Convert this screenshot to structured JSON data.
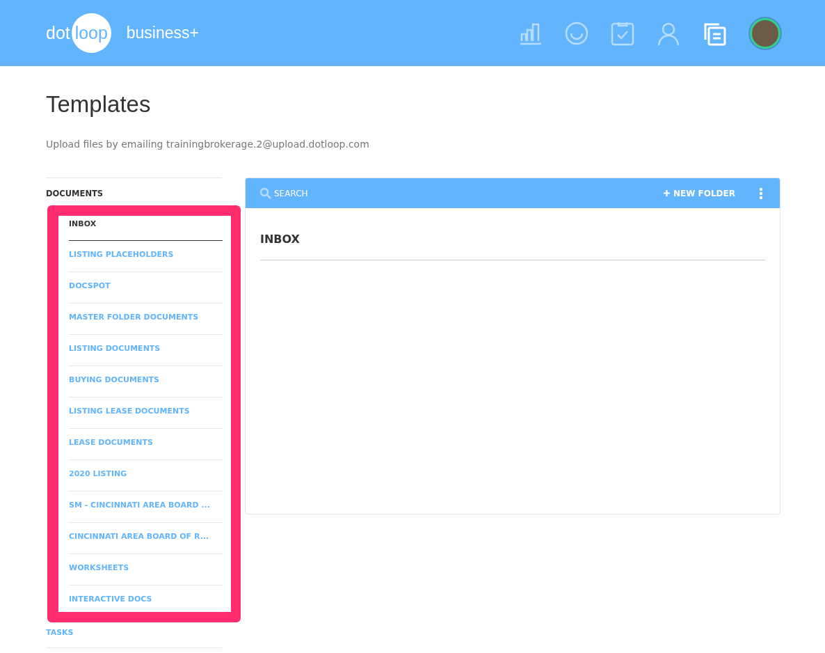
{
  "header": {
    "logo": {
      "left": "dot",
      "circle": "loop"
    },
    "plan": "business+",
    "nav_icons": [
      {
        "selected": false
      },
      {
        "selected": false
      },
      {
        "selected": false
      },
      {
        "selected": false
      },
      {
        "selected": true
      }
    ]
  },
  "page": {
    "title": "Templates",
    "subtitle": "Upload files by emailing trainingbrokerage.2@upload.dotloop.com"
  },
  "sidebar": {
    "section": "DOCUMENTS",
    "highlighted": true,
    "items": [
      {
        "label": "INBOX",
        "selected": true
      },
      {
        "label": "LISTING PLACEHOLDERS",
        "selected": false
      },
      {
        "label": "DOCSPOT",
        "selected": false
      },
      {
        "label": "MASTER FOLDER DOCUMENTS",
        "selected": false
      },
      {
        "label": "LISTING DOCUMENTS",
        "selected": false
      },
      {
        "label": "BUYING DOCUMENTS",
        "selected": false
      },
      {
        "label": "LISTING LEASE DOCUMENTS",
        "selected": false
      },
      {
        "label": "LEASE DOCUMENTS",
        "selected": false
      },
      {
        "label": "2020 LISTING",
        "selected": false
      },
      {
        "label": "SM - CINCINNATI AREA BOARD ...",
        "selected": false
      },
      {
        "label": "CINCINNATI AREA BOARD OF R...",
        "selected": false
      },
      {
        "label": "WORKSHEETS",
        "selected": false
      },
      {
        "label": "INTERACTIVE DOCS",
        "selected": false
      }
    ],
    "next_section": "TASKS"
  },
  "panel": {
    "search": {
      "placeholder": "SEARCH"
    },
    "new_folder": "NEW FOLDER",
    "folder_title": "INBOX"
  }
}
